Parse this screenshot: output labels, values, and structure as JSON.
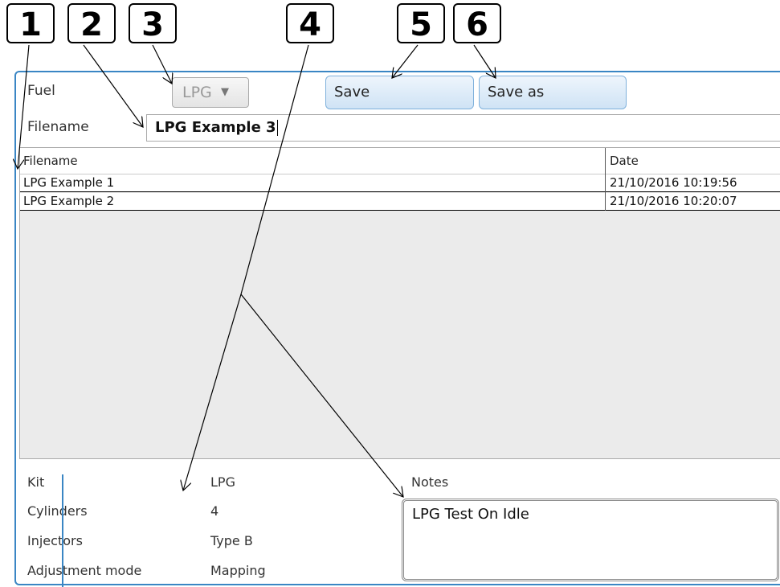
{
  "callouts": [
    "1",
    "2",
    "3",
    "4",
    "5",
    "6"
  ],
  "form": {
    "fuel_label": "Fuel",
    "fuel_value": "LPG",
    "save_label": "Save",
    "save_as_label": "Save as",
    "filename_label": "Filename",
    "filename_value": "LPG Example 3"
  },
  "table": {
    "columns": [
      "Filename",
      "Date"
    ],
    "rows": [
      [
        "LPG Example 1",
        "21/10/2016 10:19:56"
      ],
      [
        "LPG Example 2",
        "21/10/2016 10:20:07"
      ]
    ]
  },
  "details": {
    "kit_label": "Kit",
    "kit_value": "LPG",
    "cylinders_label": "Cylinders",
    "cylinders_value": "4",
    "injectors_label": "Injectors",
    "injectors_value": "Type B",
    "mode_label": "Adjustment mode",
    "mode_value": "Mapping",
    "notes_label": "Notes",
    "notes_value": "LPG Test On Idle"
  },
  "colors": {
    "accent": "#3a86c4",
    "button_bg": "#cfe3f5"
  }
}
